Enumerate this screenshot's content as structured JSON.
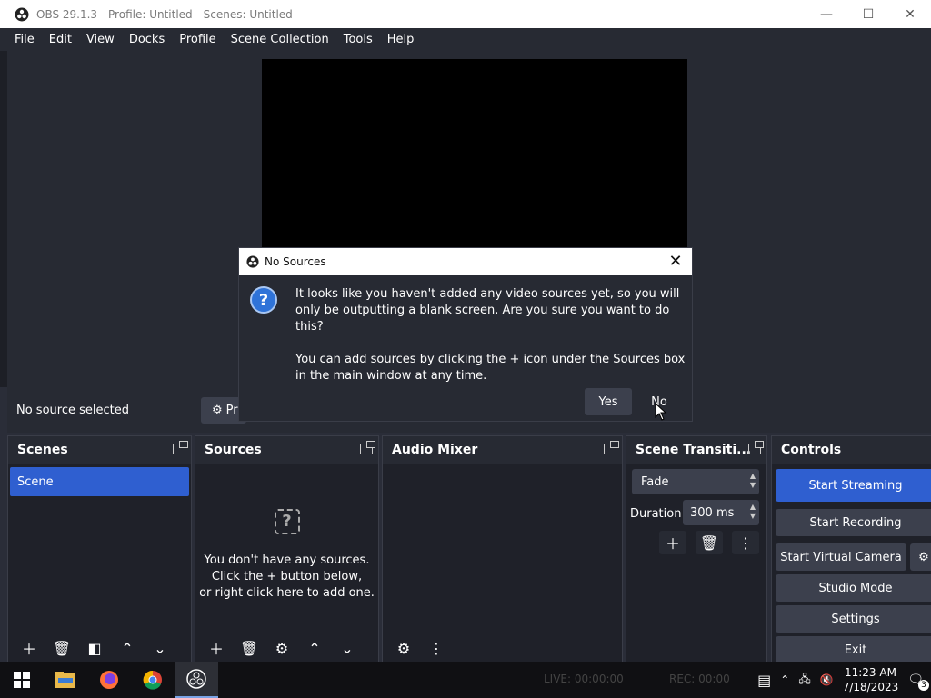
{
  "window": {
    "title": "OBS 29.1.3 - Profile: Untitled - Scenes: Untitled",
    "minimize": "—",
    "maximize": "☐",
    "close": "✕"
  },
  "menu": [
    "File",
    "Edit",
    "View",
    "Docks",
    "Profile",
    "Scene Collection",
    "Tools",
    "Help"
  ],
  "status_row": {
    "no_source": "No source selected",
    "properties_label": "Pr"
  },
  "docks": {
    "scenes": {
      "title": "Scenes",
      "items": [
        "Scene"
      ]
    },
    "sources": {
      "title": "Sources",
      "empty_line1": "You don't have any sources.",
      "empty_line2": "Click the + button below,",
      "empty_line3": "or right click here to add one."
    },
    "audio_mixer": {
      "title": "Audio Mixer"
    },
    "transitions": {
      "title": "Scene Transiti...",
      "selected": "Fade",
      "duration_label": "Duration",
      "duration_value": "300 ms"
    },
    "controls": {
      "title": "Controls",
      "start_streaming": "Start Streaming",
      "start_recording": "Start Recording",
      "start_virtual_camera": "Start Virtual Camera",
      "studio_mode": "Studio Mode",
      "settings": "Settings",
      "exit": "Exit"
    }
  },
  "dialog": {
    "title": "No Sources",
    "message1": "It looks like you haven't added any video sources yet, so you will only be outputting a blank screen. Are you sure you want to do this?",
    "message2": "You can add sources by clicking the + icon under the Sources box in the main window at any time.",
    "yes": "Yes",
    "no": "No"
  },
  "taskbar": {
    "live": "LIVE: 00:00:00",
    "rec": "REC: 00:00",
    "time": "11:23 AM",
    "date": "7/18/2023",
    "notifications": "3"
  },
  "colors": {
    "accent": "#2f5fd0",
    "panel": "#272a33",
    "dock_bg": "#1f2129"
  }
}
